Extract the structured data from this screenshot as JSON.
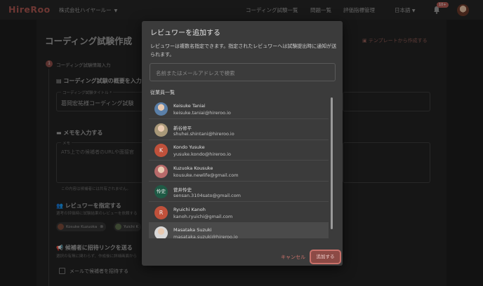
{
  "header": {
    "logo": "HireRoo",
    "company": "株式会社ハイヤールー",
    "nav": [
      "コーディング試験一覧",
      "問題一覧",
      "評価指標管理"
    ],
    "language": "日本語",
    "notification_badge": "10+"
  },
  "page": {
    "title": "コーディング試験作成",
    "template_link": "テンプレートから作成する",
    "step_number": "1",
    "step_label": "コーディング試験情報入力",
    "overview_title": "コーディング試験の概要を入力",
    "test_title_label": "コーディング試験タイトル *",
    "test_title_value": "葛岡宏祐様コーディング試験",
    "memo_title": "メモを入力する",
    "memo_label": "メモ",
    "memo_placeholder": "ATS上での候補者のURLや面接官",
    "memo_note": "この内容は候補者には共有されません。",
    "reviewer_title": "レビュワーを指定する",
    "reviewer_desc": "選考の評価時に試験結果のレビューを依頼する",
    "chips": [
      "Kosuke Kuzuoka",
      "Yuichi K"
    ],
    "invite_title": "候補者に招待リンクを送る",
    "invite_desc": "選択の有無に関わらず、作成後に詳細画面から",
    "invite_checkbox_label": "メールで候補者を招待する"
  },
  "modal": {
    "title": "レビュワーを追加する",
    "description": "レビュワーは複数名指定できます。指定されたレビュワーへは試験提出時に通知が送られます。",
    "search_placeholder": "名前またはメールアドレスで検索",
    "list_title": "従業員一覧",
    "employees": [
      {
        "name": "Keisuke Taniai",
        "email": "keisuke.taniai@hireroo.io",
        "avatar": "photo",
        "color": "#5a7fa8"
      },
      {
        "name": "新谷修平",
        "email": "shuhei.shintani@hireroo.io",
        "avatar": "photo",
        "color": "#a89878"
      },
      {
        "name": "Kondo Yusuke",
        "email": "yusuke.kondo@hireroo.io",
        "avatar": "K",
        "color": "#c0513b"
      },
      {
        "name": "Kuzuoka Kousuke",
        "email": "kousuke.newlife@gmail.com",
        "avatar": "photo",
        "color": "#b86a6a"
      },
      {
        "name": "菅井怜史",
        "email": "sensan.3104sato@gmail.com",
        "avatar": "怜史",
        "color": "#1f5a45"
      },
      {
        "name": "Ryuichi Kanoh",
        "email": "kanoh.ryuichi@gmail.com",
        "avatar": "R",
        "color": "#c0513b"
      },
      {
        "name": "Masataka Suzuki",
        "email": "masataka.suzuki@hireroo.io",
        "avatar": "photo",
        "color": "#d8d8d8"
      }
    ],
    "cancel_label": "キャンセル",
    "add_label": "追加する"
  },
  "colors": {
    "accent": "#c9716a",
    "brand": "#a8554f"
  }
}
